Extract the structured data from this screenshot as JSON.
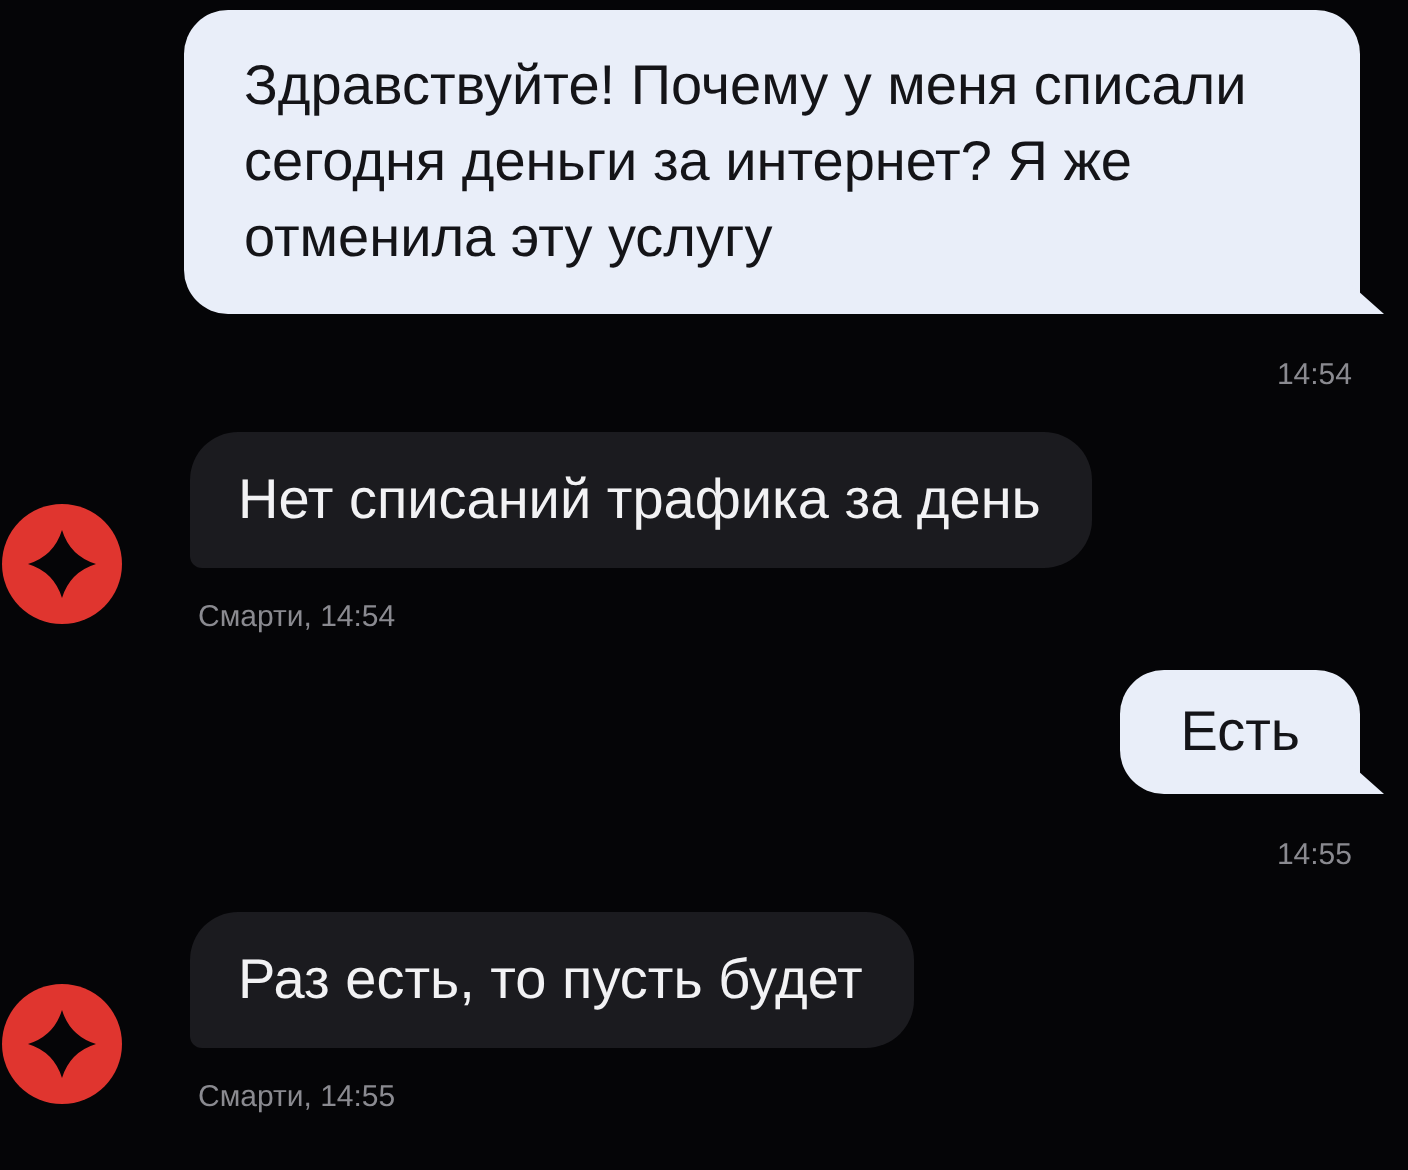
{
  "messages": [
    {
      "kind": "outgoing",
      "text": "Здравствуйте! Почему у меня списали сегодня деньги за интернет? Я же отменила эту услугу",
      "time": "14:54"
    },
    {
      "kind": "incoming",
      "text": "Нет списаний трафика за день",
      "meta": "Смарти, 14:54"
    },
    {
      "kind": "outgoing",
      "text": "Есть",
      "time": "14:55"
    },
    {
      "kind": "incoming",
      "text": "Раз есть, то пусть будет",
      "meta": "Смарти, 14:55"
    }
  ]
}
